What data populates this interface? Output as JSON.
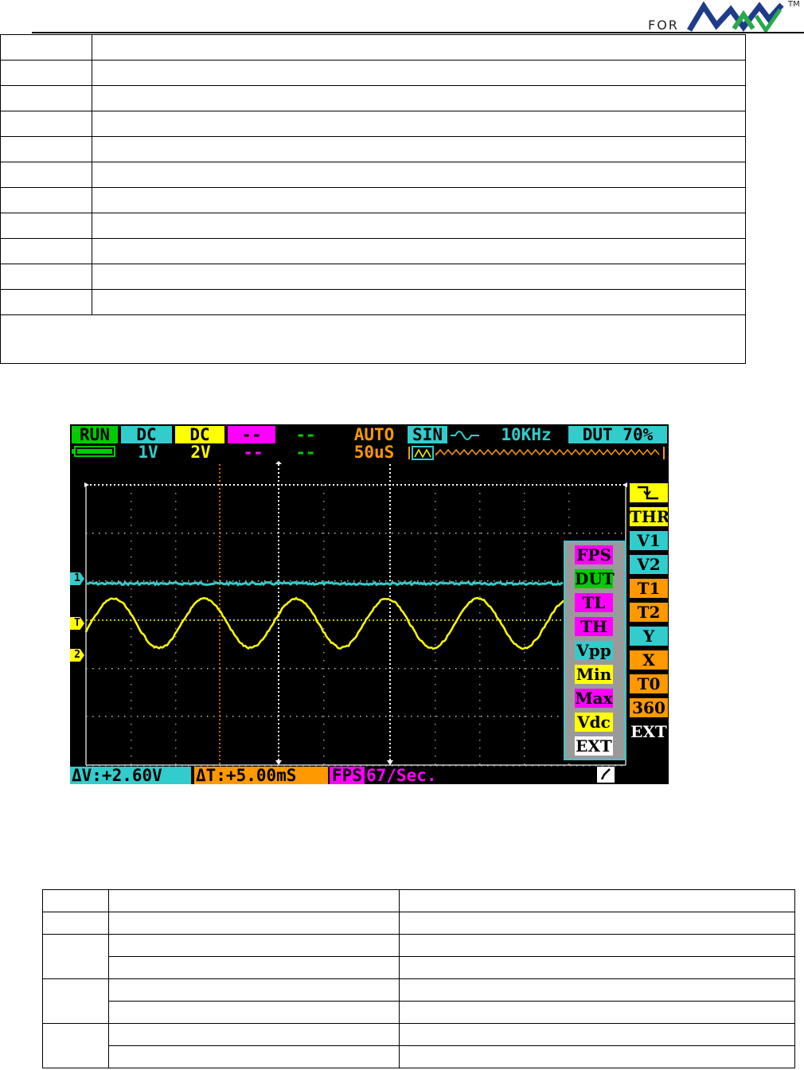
{
  "header": {
    "for_label": "FOR",
    "logo_name": "minidso-logo",
    "tm": "TM"
  },
  "scope": {
    "top_bar": {
      "status": "RUN",
      "ch1_coupling": "DC",
      "ch2_coupling": "DC",
      "ch3": "--",
      "ch4": "--",
      "mode": "AUTO",
      "generator": "SIN",
      "frequency": "10KHz",
      "duty": "DUT 70%"
    },
    "second_bar": {
      "ch1_scale": "1V",
      "ch2_scale": "2V",
      "ch3": "--",
      "ch4": "--",
      "timebase": "50uS"
    },
    "markers": {
      "ch1": "1",
      "trigger": "T",
      "ch2": "2"
    },
    "measure_menu": [
      "FPS",
      "DUT",
      "TL",
      "TH",
      "Vpp",
      "Min",
      "Max",
      "Vdc",
      "EXT"
    ],
    "side_menu": [
      "THR",
      "V1",
      "V2",
      "T1",
      "T2",
      "Y",
      "X",
      "T0",
      "360",
      "EXT"
    ],
    "bottom_bar": {
      "delta_v": "ΔV:+2.60V",
      "delta_t": "ΔT:+5.00mS",
      "fps_label": "FPS",
      "fps_value": "67/Sec."
    },
    "colors": {
      "ch1": "#33cccc",
      "ch2": "#ffff00",
      "orange": "#ff9900",
      "magenta": "#ff00ff",
      "green": "#00cc00"
    }
  }
}
